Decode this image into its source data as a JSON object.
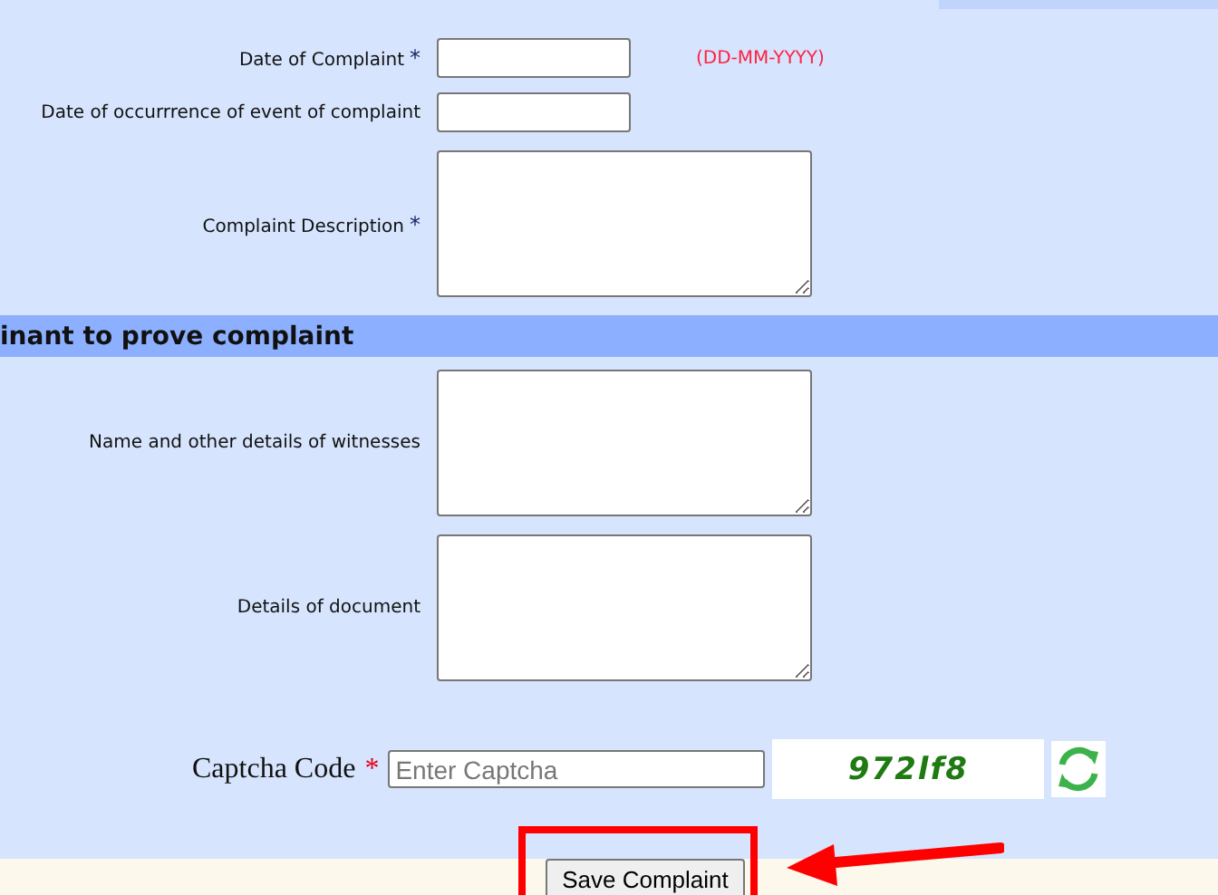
{
  "top_fields": [
    {
      "label": "Date of Complaint",
      "marker": "*",
      "kind": "input",
      "hint": "(DD-MM-YYYY)"
    },
    {
      "label": "Date of occurrrence of event of complaint",
      "kind": "input"
    },
    {
      "label": "Complaint Description",
      "marker": "*",
      "kind": "textarea"
    }
  ],
  "section_header": "inant to prove complaint",
  "evidence_fields": [
    {
      "label": "Name and other details of witnesses",
      "kind": "textarea"
    },
    {
      "label": "Details of document",
      "kind": "textarea"
    }
  ],
  "captcha": {
    "label": "Captcha Code",
    "marker": "*",
    "placeholder": "Enter Captcha",
    "code": "972lf8"
  },
  "save_button": "Save Complaint"
}
